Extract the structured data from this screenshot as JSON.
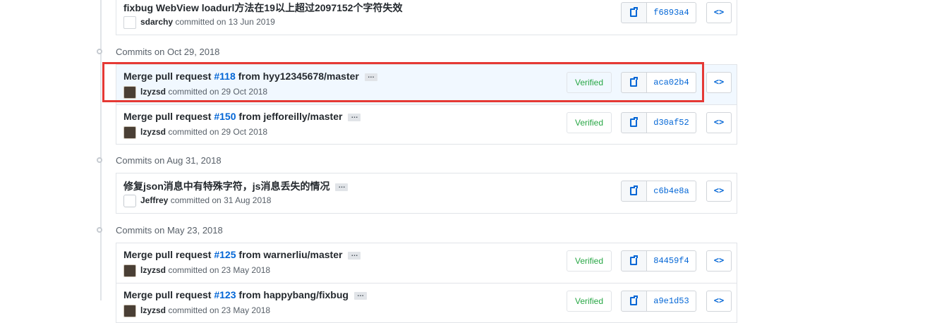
{
  "groups": [
    {
      "header": "",
      "commits": [
        {
          "msg_pre": "fixbug WebView loadurl方法在19以上超过2097152个字符失效",
          "pr": "",
          "msg_post": "",
          "author": "sdarchy",
          "meta": "committed on 13 Jun 2019",
          "verified": "",
          "sha": "f6893a4",
          "avatar": "broken"
        }
      ]
    },
    {
      "header": "Commits on Oct 29, 2018",
      "commits": [
        {
          "msg_pre": "Merge pull request ",
          "pr": "#118",
          "msg_post": " from hyy12345678/master",
          "author": "lzyzsd",
          "meta": "committed on 29 Oct 2018",
          "verified": "Verified",
          "sha": "aca02b4",
          "avatar": "photo",
          "highlighted": true
        },
        {
          "msg_pre": "Merge pull request ",
          "pr": "#150",
          "msg_post": " from jefforeilly/master",
          "author": "lzyzsd",
          "meta": "committed on 29 Oct 2018",
          "verified": "Verified",
          "sha": "d30af52",
          "avatar": "photo"
        }
      ]
    },
    {
      "header": "Commits on Aug 31, 2018",
      "commits": [
        {
          "msg_pre": "修复json消息中有特殊字符，js消息丢失的情况",
          "pr": "",
          "msg_post": "",
          "author": "Jeffrey",
          "meta": "committed on 31 Aug 2018",
          "verified": "",
          "sha": "c6b4e8a",
          "avatar": "ghost"
        }
      ]
    },
    {
      "header": "Commits on May 23, 2018",
      "commits": [
        {
          "msg_pre": "Merge pull request ",
          "pr": "#125",
          "msg_post": " from warnerliu/master",
          "author": "lzyzsd",
          "meta": "committed on 23 May 2018",
          "verified": "Verified",
          "sha": "84459f4",
          "avatar": "photo"
        },
        {
          "msg_pre": "Merge pull request ",
          "pr": "#123",
          "msg_post": " from happybang/fixbug",
          "author": "lzyzsd",
          "meta": "committed on 23 May 2018",
          "verified": "Verified",
          "sha": "a9e1d53",
          "avatar": "photo"
        }
      ]
    }
  ],
  "ellipsis_label": "…",
  "browse_label": "<>",
  "colors": {
    "link": "#0366d6",
    "verified": "#28a745",
    "highlight_frame": "#e53935",
    "highlight_row": "#f1f8ff"
  }
}
